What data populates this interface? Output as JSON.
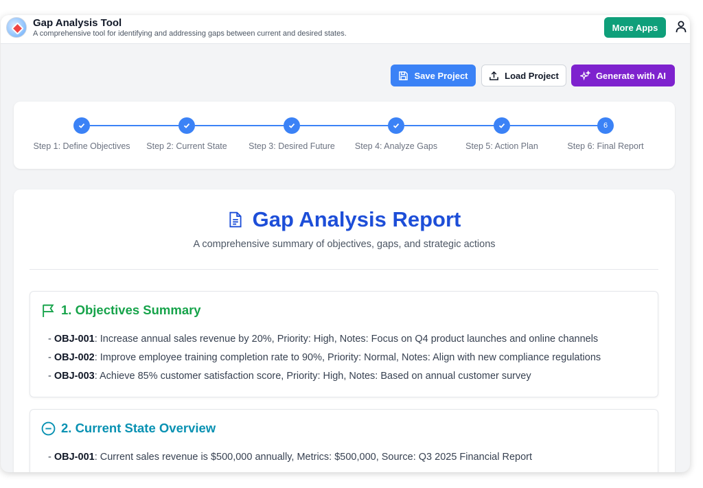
{
  "app": {
    "title": "Gap Analysis Tool",
    "subtitle": "A comprehensive tool for identifying and addressing gaps between current and desired states.",
    "more_apps_label": "More Apps"
  },
  "toolbar": {
    "save_label": "Save Project",
    "load_label": "Load Project",
    "ai_label": "Generate with AI"
  },
  "stepper": {
    "steps": [
      {
        "label": "Step 1: Define Objectives",
        "state": "done"
      },
      {
        "label": "Step 2: Current State",
        "state": "done"
      },
      {
        "label": "Step 3: Desired Future",
        "state": "done"
      },
      {
        "label": "Step 4: Analyze Gaps",
        "state": "done"
      },
      {
        "label": "Step 5: Action Plan",
        "state": "done"
      },
      {
        "label": "Step 6: Final Report",
        "state": "current",
        "number": "6"
      }
    ]
  },
  "report": {
    "title": "Gap Analysis Report",
    "subtitle": "A comprehensive summary of objectives, gaps, and strategic actions",
    "sections": [
      {
        "heading": "1. Objectives Summary",
        "items": [
          {
            "prefix": "- ",
            "id": "OBJ-001",
            "text": ": Increase annual sales revenue by 20%, Priority: High, Notes: Focus on Q4 product launches and online channels"
          },
          {
            "prefix": "- ",
            "id": "OBJ-002",
            "text": ": Improve employee training completion rate to 90%, Priority: Normal, Notes: Align with new compliance regulations"
          },
          {
            "prefix": "- ",
            "id": "OBJ-003",
            "text": ": Achieve 85% customer satisfaction score, Priority: High, Notes: Based on annual customer survey"
          }
        ]
      },
      {
        "heading": "2. Current State Overview",
        "items": [
          {
            "prefix": "- ",
            "id": "OBJ-001",
            "text": ": Current sales revenue is $500,000 annually, Metrics: $500,000, Source: Q3 2025 Financial Report"
          }
        ]
      }
    ]
  },
  "colors": {
    "primary": "#3b82f6",
    "title_blue": "#1d4ed8",
    "green": "#16a34a",
    "teal": "#0891b2",
    "purple": "#7e22ce",
    "more_apps": "#0f9f7a"
  }
}
